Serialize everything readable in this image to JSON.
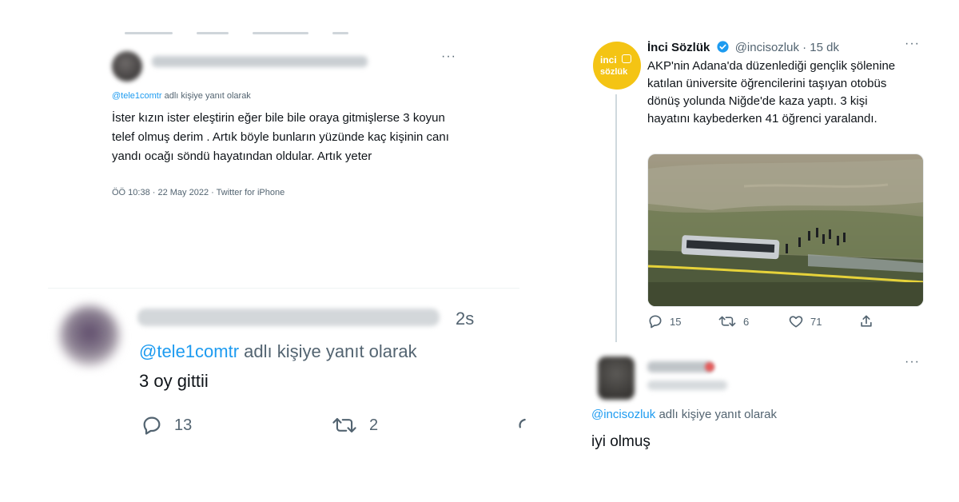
{
  "left_top_tweet": {
    "reply_prefix_handle": "@tele1comtr",
    "reply_suffix": "adlı kişiye yanıt olarak",
    "text": "İster kızın ister eleştirin eğer bile bile oraya gitmişlerse 3 koyun telef olmuş derim . Artık böyle bunların yüzünde kaç kişinin canı yandı ocağı söndü hayatından oldular. Artık yeter",
    "meta": "ÖÖ 10:38 · 22 May 2022 · Twitter for iPhone",
    "more_icon": "more-icon"
  },
  "left_bottom_tweet": {
    "time": "2s",
    "reply_prefix_handle": "@tele1comtr",
    "reply_suffix": "adlı kişiye yanıt olarak",
    "text": "3 oy gittii",
    "reply_count": "13",
    "retweet_count": "2"
  },
  "right_top_tweet": {
    "logo_line1": "inci",
    "logo_line2": "sözlük",
    "name": "İnci Sözlük",
    "handle_time": "@incisozluk · 15 dk",
    "text": "AKP'nin Adana'da düzenlediği gençlik şölenine katılan üniversite öğrencilerini taşıyan otobüs dönüş yolunda Niğde'de kaza yaptı. 3 kişi hayatını kaybederken 41 öğrenci yaralandı.",
    "reply_count": "15",
    "retweet_count": "6",
    "like_count": "71",
    "verified_color": "#1d9bf0",
    "logo_color": "#f4c414"
  },
  "right_bottom_tweet": {
    "reply_prefix_handle": "@incisozluk",
    "reply_suffix": "adlı kişiye yanıt olarak",
    "text": "iyi olmuş"
  }
}
